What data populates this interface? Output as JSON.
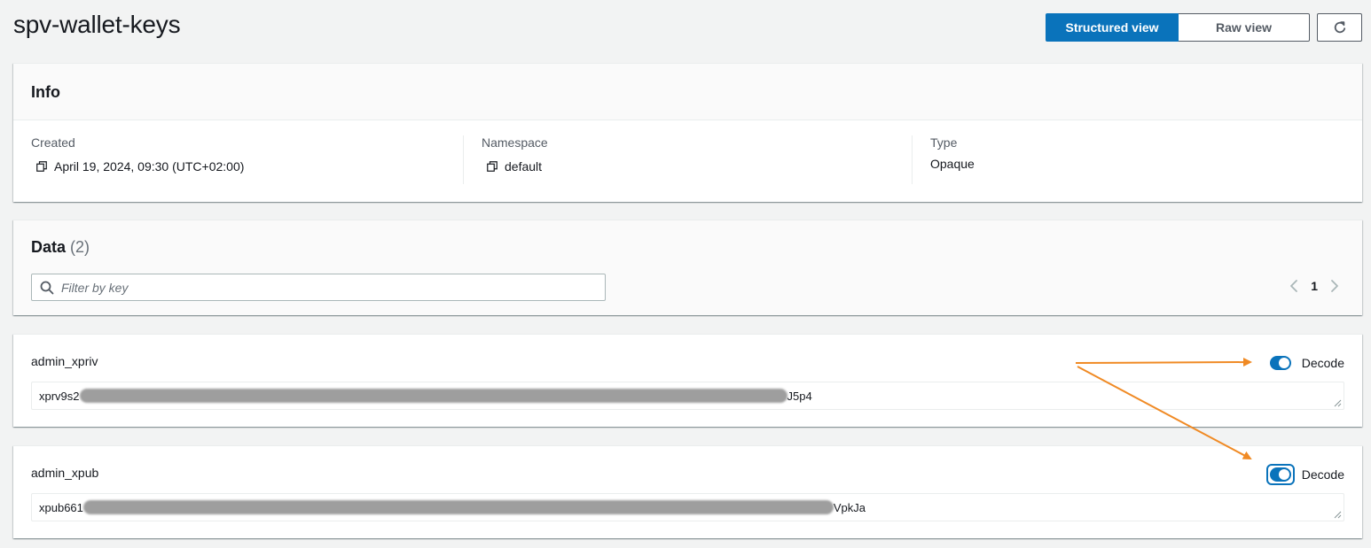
{
  "header": {
    "title": "spv-wallet-keys",
    "view_structured": "Structured view",
    "view_raw": "Raw view"
  },
  "info": {
    "title": "Info",
    "created_label": "Created",
    "created_value": "April 19, 2024, 09:30 (UTC+02:00)",
    "namespace_label": "Namespace",
    "namespace_value": "default",
    "type_label": "Type",
    "type_value": "Opaque"
  },
  "data": {
    "title": "Data",
    "count": "(2)",
    "filter_placeholder": "Filter by key",
    "page": "1",
    "entries": [
      {
        "key": "admin_xpriv",
        "prefix": "xprv9s2",
        "suffix": "J5p4",
        "decode_label": "Decode",
        "decoded": true
      },
      {
        "key": "admin_xpub",
        "prefix": "xpub661",
        "suffix": "VpkJa",
        "decode_label": "Decode",
        "decoded": true
      }
    ]
  },
  "colors": {
    "primary": "#0a73bb",
    "annotation": "#f08a24",
    "background": "#f2f3f3"
  }
}
